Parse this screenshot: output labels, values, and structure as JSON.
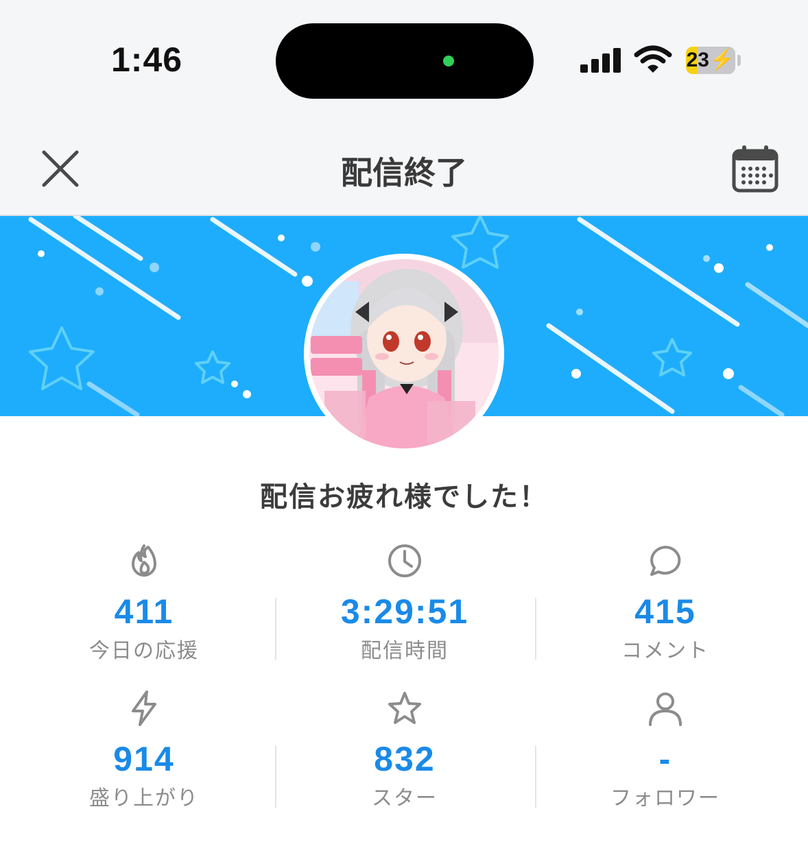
{
  "status_bar": {
    "time": "1:46",
    "battery_percent": "23",
    "battery_level": 0.23,
    "camera_indicator_color": "#2fd158"
  },
  "navbar": {
    "title": "配信終了",
    "close_icon": "close-icon",
    "calendar_icon": "calendar-icon"
  },
  "banner": {
    "background_color": "#1eadfc"
  },
  "message": "配信お疲れ様でした！",
  "stats": [
    {
      "icon": "flame-icon",
      "value": "411",
      "label": "今日の応援"
    },
    {
      "icon": "clock-icon",
      "value": "3:29:51",
      "label": "配信時間"
    },
    {
      "icon": "comment-icon",
      "value": "415",
      "label": "コメント"
    },
    {
      "icon": "lightning-icon",
      "value": "914",
      "label": "盛り上がり"
    },
    {
      "icon": "star-icon",
      "value": "832",
      "label": "スター"
    },
    {
      "icon": "person-icon",
      "value": "-",
      "label": "フォロワー"
    }
  ],
  "colors": {
    "accent": "#1a8ae8",
    "label": "#8c8c8c",
    "icon": "#8c8c8c"
  }
}
